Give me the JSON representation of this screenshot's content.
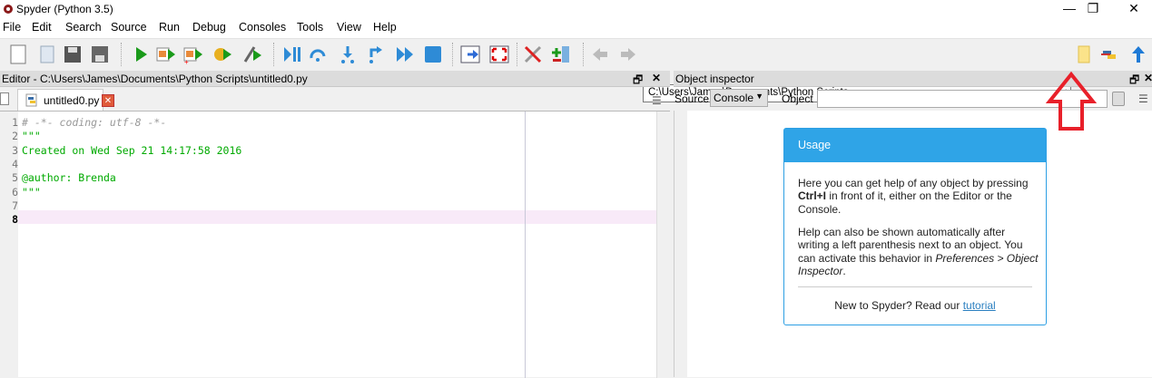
{
  "window": {
    "title": "Spyder (Python 3.5)",
    "minimize": "—",
    "restore": "❐",
    "close": "✕"
  },
  "menu": [
    "File",
    "Edit",
    "Search",
    "Source",
    "Run",
    "Debug",
    "Consoles",
    "Tools",
    "View",
    "Help"
  ],
  "toolbar": {
    "path": "C:\\Users\\James\\Documents\\Python Scripts",
    "icons": [
      "new-file",
      "open-file",
      "save",
      "save-all",
      "run",
      "run-cell",
      "run-cell-advance",
      "run-selection",
      "debug-file",
      "debug-continue",
      "step",
      "step-into",
      "step-return",
      "continue",
      "stop",
      "maximize-pane",
      "fullscreen",
      "preferences",
      "pythonpath-manager",
      "back",
      "forward",
      "browse-folder",
      "python-set-cwd",
      "parent-directory"
    ]
  },
  "editor": {
    "header": "Editor - C:\\Users\\James\\Documents\\Python Scripts\\untitled0.py",
    "tab": "untitled0.py",
    "lines": [
      {
        "n": "1",
        "text": "# -*- coding: utf-8 -*-",
        "color": "#999999"
      },
      {
        "n": "2",
        "text": "\"\"\"",
        "color": "#00aa00"
      },
      {
        "n": "3",
        "text": "Created on Wed Sep 21 14:17:58 2016",
        "color": "#00aa00"
      },
      {
        "n": "4",
        "text": "",
        "color": "#00aa00"
      },
      {
        "n": "5",
        "text": "@author: Brenda",
        "color": "#00aa00"
      },
      {
        "n": "6",
        "text": "\"\"\"",
        "color": "#00aa00"
      },
      {
        "n": "7",
        "text": "",
        "color": "#000000"
      },
      {
        "n": "8",
        "text": "",
        "color": "#000000"
      }
    ],
    "current_line": "8"
  },
  "inspector": {
    "header": "Object inspector",
    "source_label": "Source",
    "source_value": "Console",
    "object_label": "Object",
    "object_value": "",
    "usage": {
      "title": "Usage",
      "p1a": "Here you can get help of any object by pressing ",
      "p1b": "Ctrl+I",
      "p1c": " in front of it, either on the Editor or the Console.",
      "p2a": "Help can also be shown automatically after writing a left parenthesis next to an object. You can activate this behavior in ",
      "p2b": "Preferences > Object Inspector",
      "p2c": ".",
      "footer": "New to Spyder? Read our ",
      "link": "tutorial"
    }
  },
  "colors": {
    "accent": "#2fa4e7",
    "annotation_arrow": "#e8202a",
    "current_line": "#f8eaf8"
  }
}
